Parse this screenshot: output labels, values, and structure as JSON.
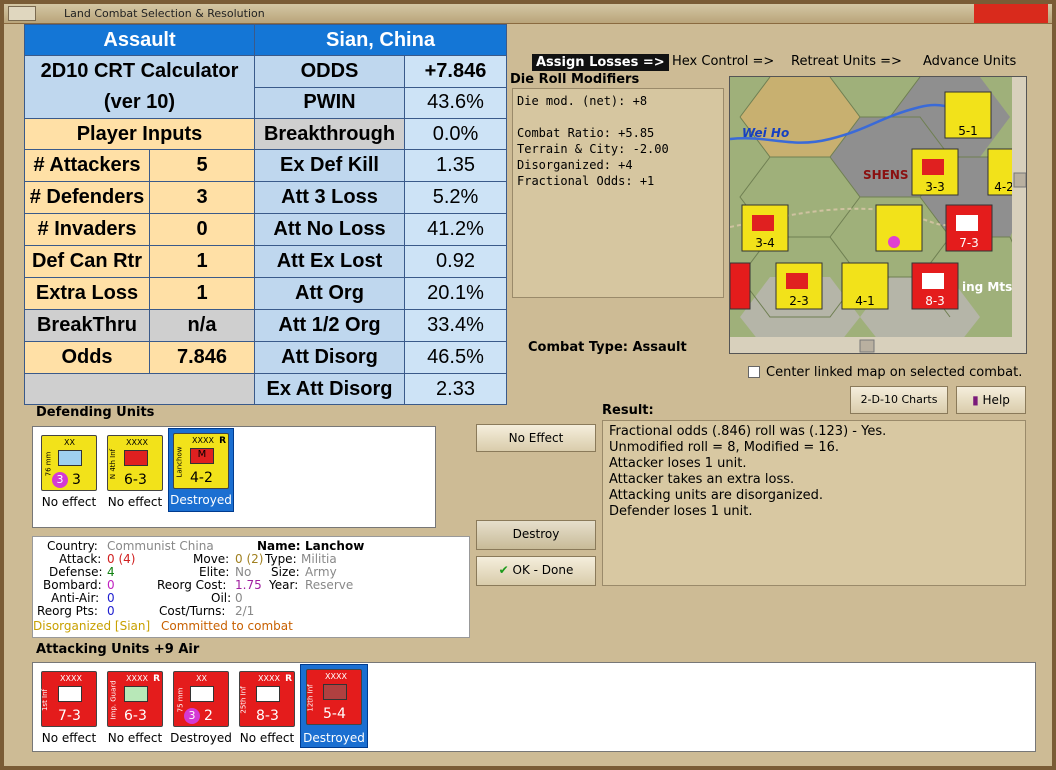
{
  "window": {
    "title": "Land Combat Selection & Resolution"
  },
  "calc": {
    "header_left": "Assault",
    "header_right": "Sian, China",
    "title1": "2D10 CRT Calculator",
    "title2": "(ver 10)",
    "player_inputs": "Player Inputs",
    "inputs": [
      {
        "label": "# Attackers",
        "value": "5"
      },
      {
        "label": "# Defenders",
        "value": "3"
      },
      {
        "label": "# Invaders",
        "value": "0"
      },
      {
        "label": "Def Can Rtr",
        "value": "1"
      },
      {
        "label": "Extra Loss",
        "value": "1"
      },
      {
        "label": "BreakThru",
        "value": "n/a"
      },
      {
        "label": "Odds",
        "value": "7.846"
      }
    ],
    "results": [
      {
        "label": "ODDS",
        "value": "+7.846"
      },
      {
        "label": "PWIN",
        "value": "43.6%"
      },
      {
        "label": "Breakthrough",
        "value": "0.0%"
      },
      {
        "label": "Ex Def Kill",
        "value": "1.35"
      },
      {
        "label": "Att 3 Loss",
        "value": "5.2%"
      },
      {
        "label": "Att No Loss",
        "value": "41.2%"
      },
      {
        "label": "Att Ex Lost",
        "value": "0.92"
      },
      {
        "label": "Att Org",
        "value": "20.1%"
      },
      {
        "label": "Att 1/2 Org",
        "value": "33.4%"
      },
      {
        "label": "Att Disorg",
        "value": "46.5%"
      },
      {
        "label": "Ex Att Disorg",
        "value": "2.33"
      }
    ]
  },
  "tabs": [
    "Assign Losses =>",
    "Hex Control =>",
    "Retreat Units =>",
    "Advance Units"
  ],
  "die_roll": {
    "title": "Die Roll Modifiers",
    "text": "Die mod. (net): +8\n\nCombat Ratio: +5.85\nTerrain & City: -2.00\nDisorganized: +4\nFractional Odds: +1"
  },
  "map": {
    "river": "Wei Ho",
    "city": "SHENS",
    "mts": "ing Mts"
  },
  "combat_type": "Combat Type:  Assault",
  "center_map": "Center linked map on selected combat.",
  "buttons": {
    "charts": "2-D-10 Charts",
    "help": "Help",
    "no_effect": "No Effect",
    "destroy": "Destroy",
    "ok": "OK - Done"
  },
  "result": {
    "title": "Result:",
    "lines": [
      "Fractional odds (.846) roll was (.123)  - Yes.",
      "Unmodified roll = 8, Modified = 16.",
      "Attacker loses 1 unit.",
      "Attacker takes an extra loss.",
      "Attacking units are disorganized.",
      "Defender loses 1 unit."
    ]
  },
  "defending": {
    "title": "Defending Units",
    "units": [
      {
        "size": "XX",
        "name": "76 mm",
        "strength": "3",
        "circle": "3",
        "status": "No effect",
        "color": "#f2e21a"
      },
      {
        "size": "XXXX",
        "name": "N 4th Inf",
        "strength": "6-3",
        "status": "No effect",
        "color": "#f2e21a"
      },
      {
        "size": "XXXX",
        "name": "Lanchow",
        "strength": "4-2",
        "status": "Destroyed",
        "color": "#f2e21a",
        "mark": "R",
        "sym": "M"
      }
    ]
  },
  "info": {
    "country_l": "Country:",
    "country_v": "Communist China",
    "attack_l": "Attack:",
    "attack_v": "0 (4)",
    "defense_l": "Defense:",
    "defense_v": "4",
    "bombard_l": "Bombard:",
    "bombard_v": "0",
    "antiair_l": "Anti-Air:",
    "antiair_v": "0",
    "reorg_l": "Reorg Pts:",
    "reorg_v": "0",
    "name_l": "Name:",
    "name_v": "Lanchow",
    "move_l": "Move:",
    "move_v": "0 (2)",
    "type_l": "Type:",
    "type_v": "Militia",
    "elite_l": "Elite:",
    "elite_v": "No",
    "size_l": "Size:",
    "size_v": "Army",
    "reorgcost_l": "Reorg Cost:",
    "reorgcost_v": "1.75",
    "year_l": "Year:",
    "year_v": "Reserve",
    "oil_l": "Oil:",
    "oil_v": "0",
    "cost_l": "Cost/Turns:",
    "cost_v": "2/1",
    "disorg": "Disorganized [Sian]",
    "committed": "Committed to combat"
  },
  "attacking": {
    "title": "Attacking Units +9 Air",
    "units": [
      {
        "size": "XXXX",
        "name": "1st Inf",
        "strength": "7-3",
        "status": "No effect"
      },
      {
        "size": "XXXX",
        "name": "Imp. Guard",
        "strength": "6-3",
        "status": "No effect",
        "mark": "R"
      },
      {
        "size": "XX",
        "name": "75 mm",
        "strength": "2",
        "circle": "3",
        "status": "Destroyed"
      },
      {
        "size": "XXXX",
        "name": "25th Inf",
        "strength": "8-3",
        "status": "No effect",
        "mark": "R"
      },
      {
        "size": "XXXX",
        "name": "12th Inf",
        "strength": "5-4",
        "status": "Destroyed"
      }
    ]
  }
}
